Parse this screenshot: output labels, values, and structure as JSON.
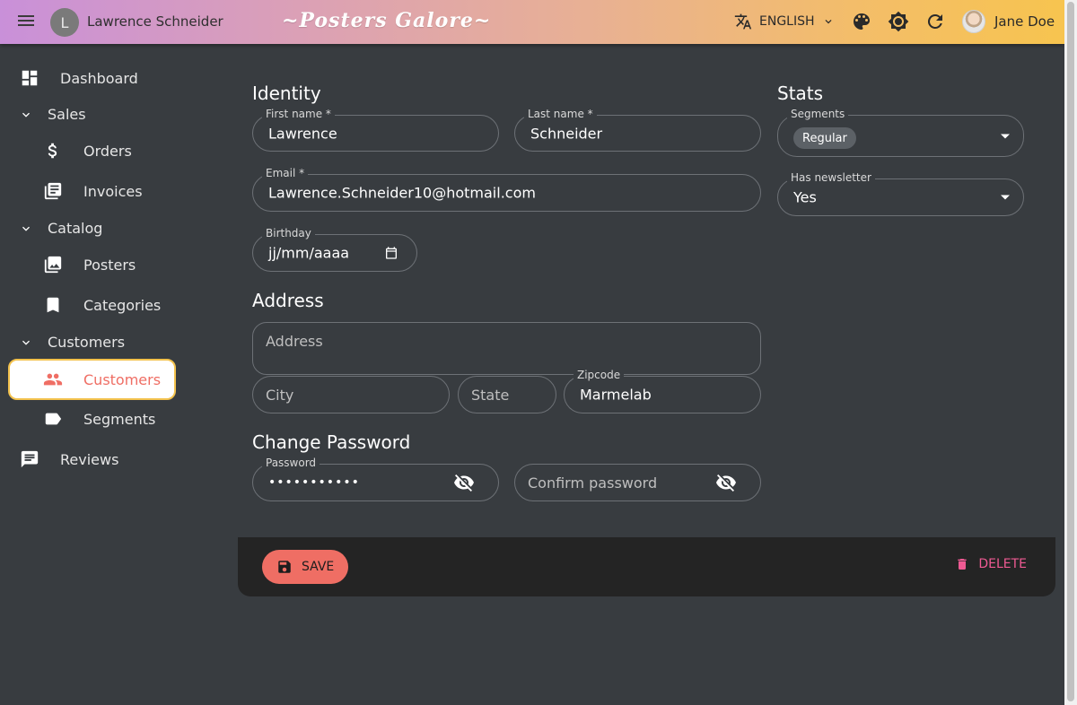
{
  "appbar": {
    "record_initial": "L",
    "record_title": "Lawrence Schneider",
    "app_title": "~Posters Galore~",
    "language": "ENGLISH",
    "user_name": "Jane Doe"
  },
  "sidebar": {
    "dashboard": "Dashboard",
    "sales": "Sales",
    "orders": "Orders",
    "invoices": "Invoices",
    "catalog": "Catalog",
    "posters": "Posters",
    "categories": "Categories",
    "customers_group": "Customers",
    "customers": "Customers",
    "segments": "Segments",
    "reviews": "Reviews"
  },
  "identity": {
    "title": "Identity",
    "first_name_label": "First name *",
    "first_name": "Lawrence",
    "last_name_label": "Last name *",
    "last_name": "Schneider",
    "email_label": "Email *",
    "email": "Lawrence.Schneider10@hotmail.com",
    "birthday_label": "Birthday",
    "birthday": "jj/mm/aaaa"
  },
  "address": {
    "title": "Address",
    "address_placeholder": "Address",
    "city_placeholder": "City",
    "state_placeholder": "State",
    "zipcode_label": "Zipcode",
    "zipcode": "Marmelab"
  },
  "password": {
    "title": "Change Password",
    "password_label": "Password",
    "password_value": "•••••••••••",
    "confirm_placeholder": "Confirm password"
  },
  "stats": {
    "title": "Stats",
    "segments_label": "Segments",
    "segment_chip": "Regular",
    "newsletter_label": "Has newsletter",
    "newsletter_value": "Yes"
  },
  "toolbar": {
    "save": "SAVE",
    "delete": "DELETE"
  },
  "colors": {
    "accent": "#ef6e64",
    "delete": "#ef5a93",
    "active_border": "#f3c24d",
    "background": "#383c40"
  }
}
